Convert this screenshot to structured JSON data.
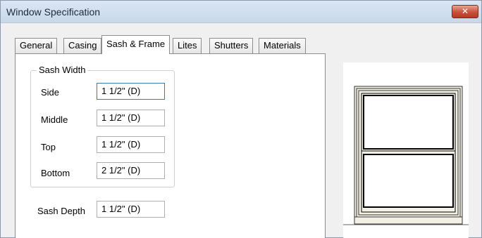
{
  "window": {
    "title": "Window Specification",
    "close_glyph": "✕"
  },
  "tabs": [
    {
      "label": "General",
      "active": false
    },
    {
      "label": "Casing",
      "active": false
    },
    {
      "label": "Sash & Frame",
      "active": true
    },
    {
      "label": "Lites",
      "active": false
    },
    {
      "label": "Shutters",
      "active": false
    },
    {
      "label": "Materials",
      "active": false
    }
  ],
  "sash_width": {
    "legend": "Sash Width",
    "fields": [
      {
        "label": "Side",
        "value": "1 1/2\" (D)"
      },
      {
        "label": "Middle",
        "value": "1 1/2\" (D)"
      },
      {
        "label": "Top",
        "value": "1 1/2\" (D)"
      },
      {
        "label": "Bottom",
        "value": "2 1/2\" (D)"
      }
    ]
  },
  "sash_depth": {
    "label": "Sash Depth",
    "value": "1 1/2\" (D)"
  },
  "preview": {
    "frame_color": "#000000",
    "wall_color": "#f3f1e6"
  }
}
